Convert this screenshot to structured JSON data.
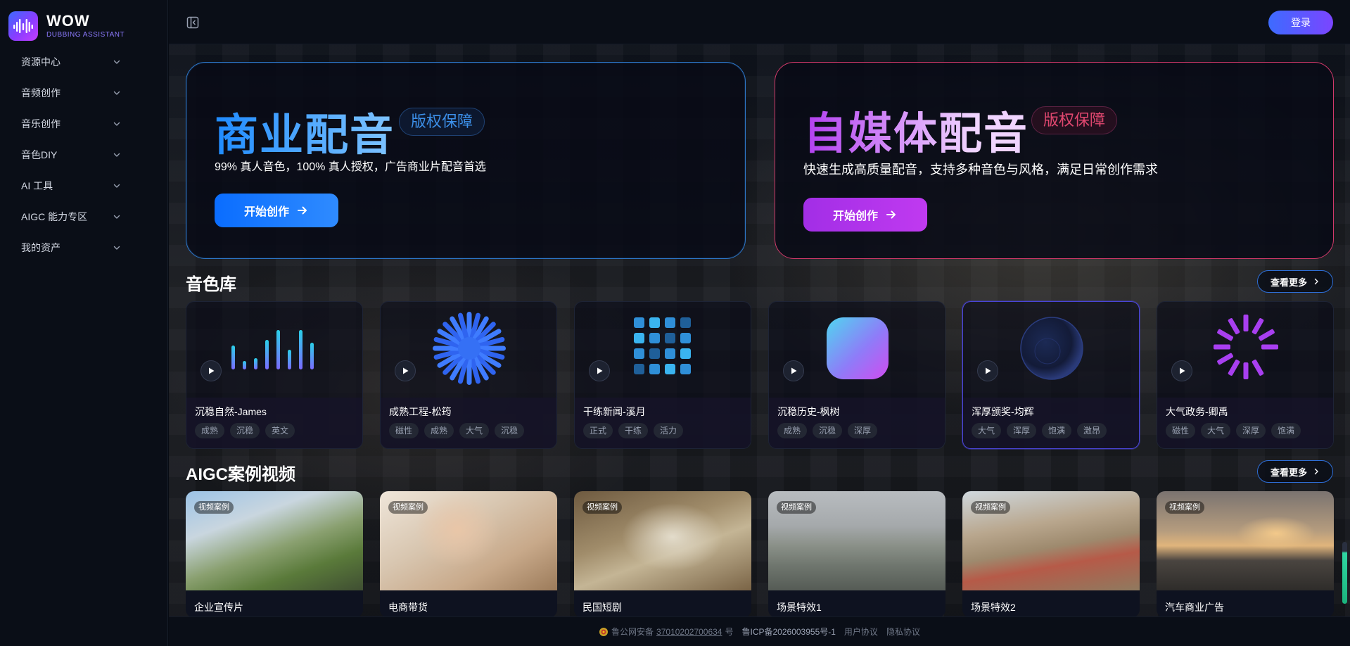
{
  "app": {
    "title": "WOW",
    "subtitle": "DUBBING ASSISTANT"
  },
  "sidebar": {
    "items": [
      {
        "label": "资源中心"
      },
      {
        "label": "音频创作"
      },
      {
        "label": "音乐创作"
      },
      {
        "label": "音色DIY"
      },
      {
        "label": "AI 工具"
      },
      {
        "label": "AIGC 能力专区"
      },
      {
        "label": "我的资产"
      }
    ]
  },
  "header": {
    "login_label": "登录"
  },
  "hero": [
    {
      "title": "商业配音",
      "badge": "版权保障",
      "desc": "99% 真人音色，100% 真人授权，广告商业片配音首选",
      "cta": "开始创作",
      "accent": "#0a6dff"
    },
    {
      "title": "自媒体配音",
      "badge": "版权保障",
      "desc": "快速生成高质量配音，支持多种音色与风格，满足日常创作需求",
      "cta": "开始创作",
      "accent": "#b23df0"
    }
  ],
  "voice_library": {
    "title": "音色库",
    "more_label": "查看更多",
    "cards": [
      {
        "name": "沉稳自然-James",
        "tags": [
          "成熟",
          "沉稳",
          "英文"
        ],
        "visual": "bars-icon"
      },
      {
        "name": "成熟工程-松筠",
        "tags": [
          "磁性",
          "成熟",
          "大气",
          "沉稳"
        ],
        "visual": "burst-icon"
      },
      {
        "name": "干练新闻-溪月",
        "tags": [
          "正式",
          "干练",
          "活力"
        ],
        "visual": "grid-icon"
      },
      {
        "name": "沉稳历史-枫树",
        "tags": [
          "成熟",
          "沉稳",
          "深厚"
        ],
        "visual": "rounded-square-icon"
      },
      {
        "name": "浑厚颁奖-均辉",
        "tags": [
          "大气",
          "浑厚",
          "饱满",
          "激昂"
        ],
        "visual": "orb-icon",
        "active": true
      },
      {
        "name": "大气政务-卿禹",
        "tags": [
          "磁性",
          "大气",
          "深厚",
          "饱满"
        ],
        "visual": "spinner-icon"
      }
    ]
  },
  "aigc_videos": {
    "title": "AIGC案例视频",
    "more_label": "查看更多",
    "cards": [
      {
        "label": "视频案例",
        "title": "企业宣传片"
      },
      {
        "label": "视频案例",
        "title": "电商带货"
      },
      {
        "label": "视频案例",
        "title": "民国短剧"
      },
      {
        "label": "视频案例",
        "title": "场景特效1"
      },
      {
        "label": "视频案例",
        "title": "场景特效2"
      },
      {
        "label": "视频案例",
        "title": "汽车商业广告"
      }
    ]
  },
  "footer": {
    "police_prefix": "鲁公网安备",
    "police_number": "37010202700634",
    "police_suffix": "号",
    "icp": "鲁ICP备2026003955号-1",
    "user_agreement": "用户协议",
    "privacy": "隐私协议"
  }
}
